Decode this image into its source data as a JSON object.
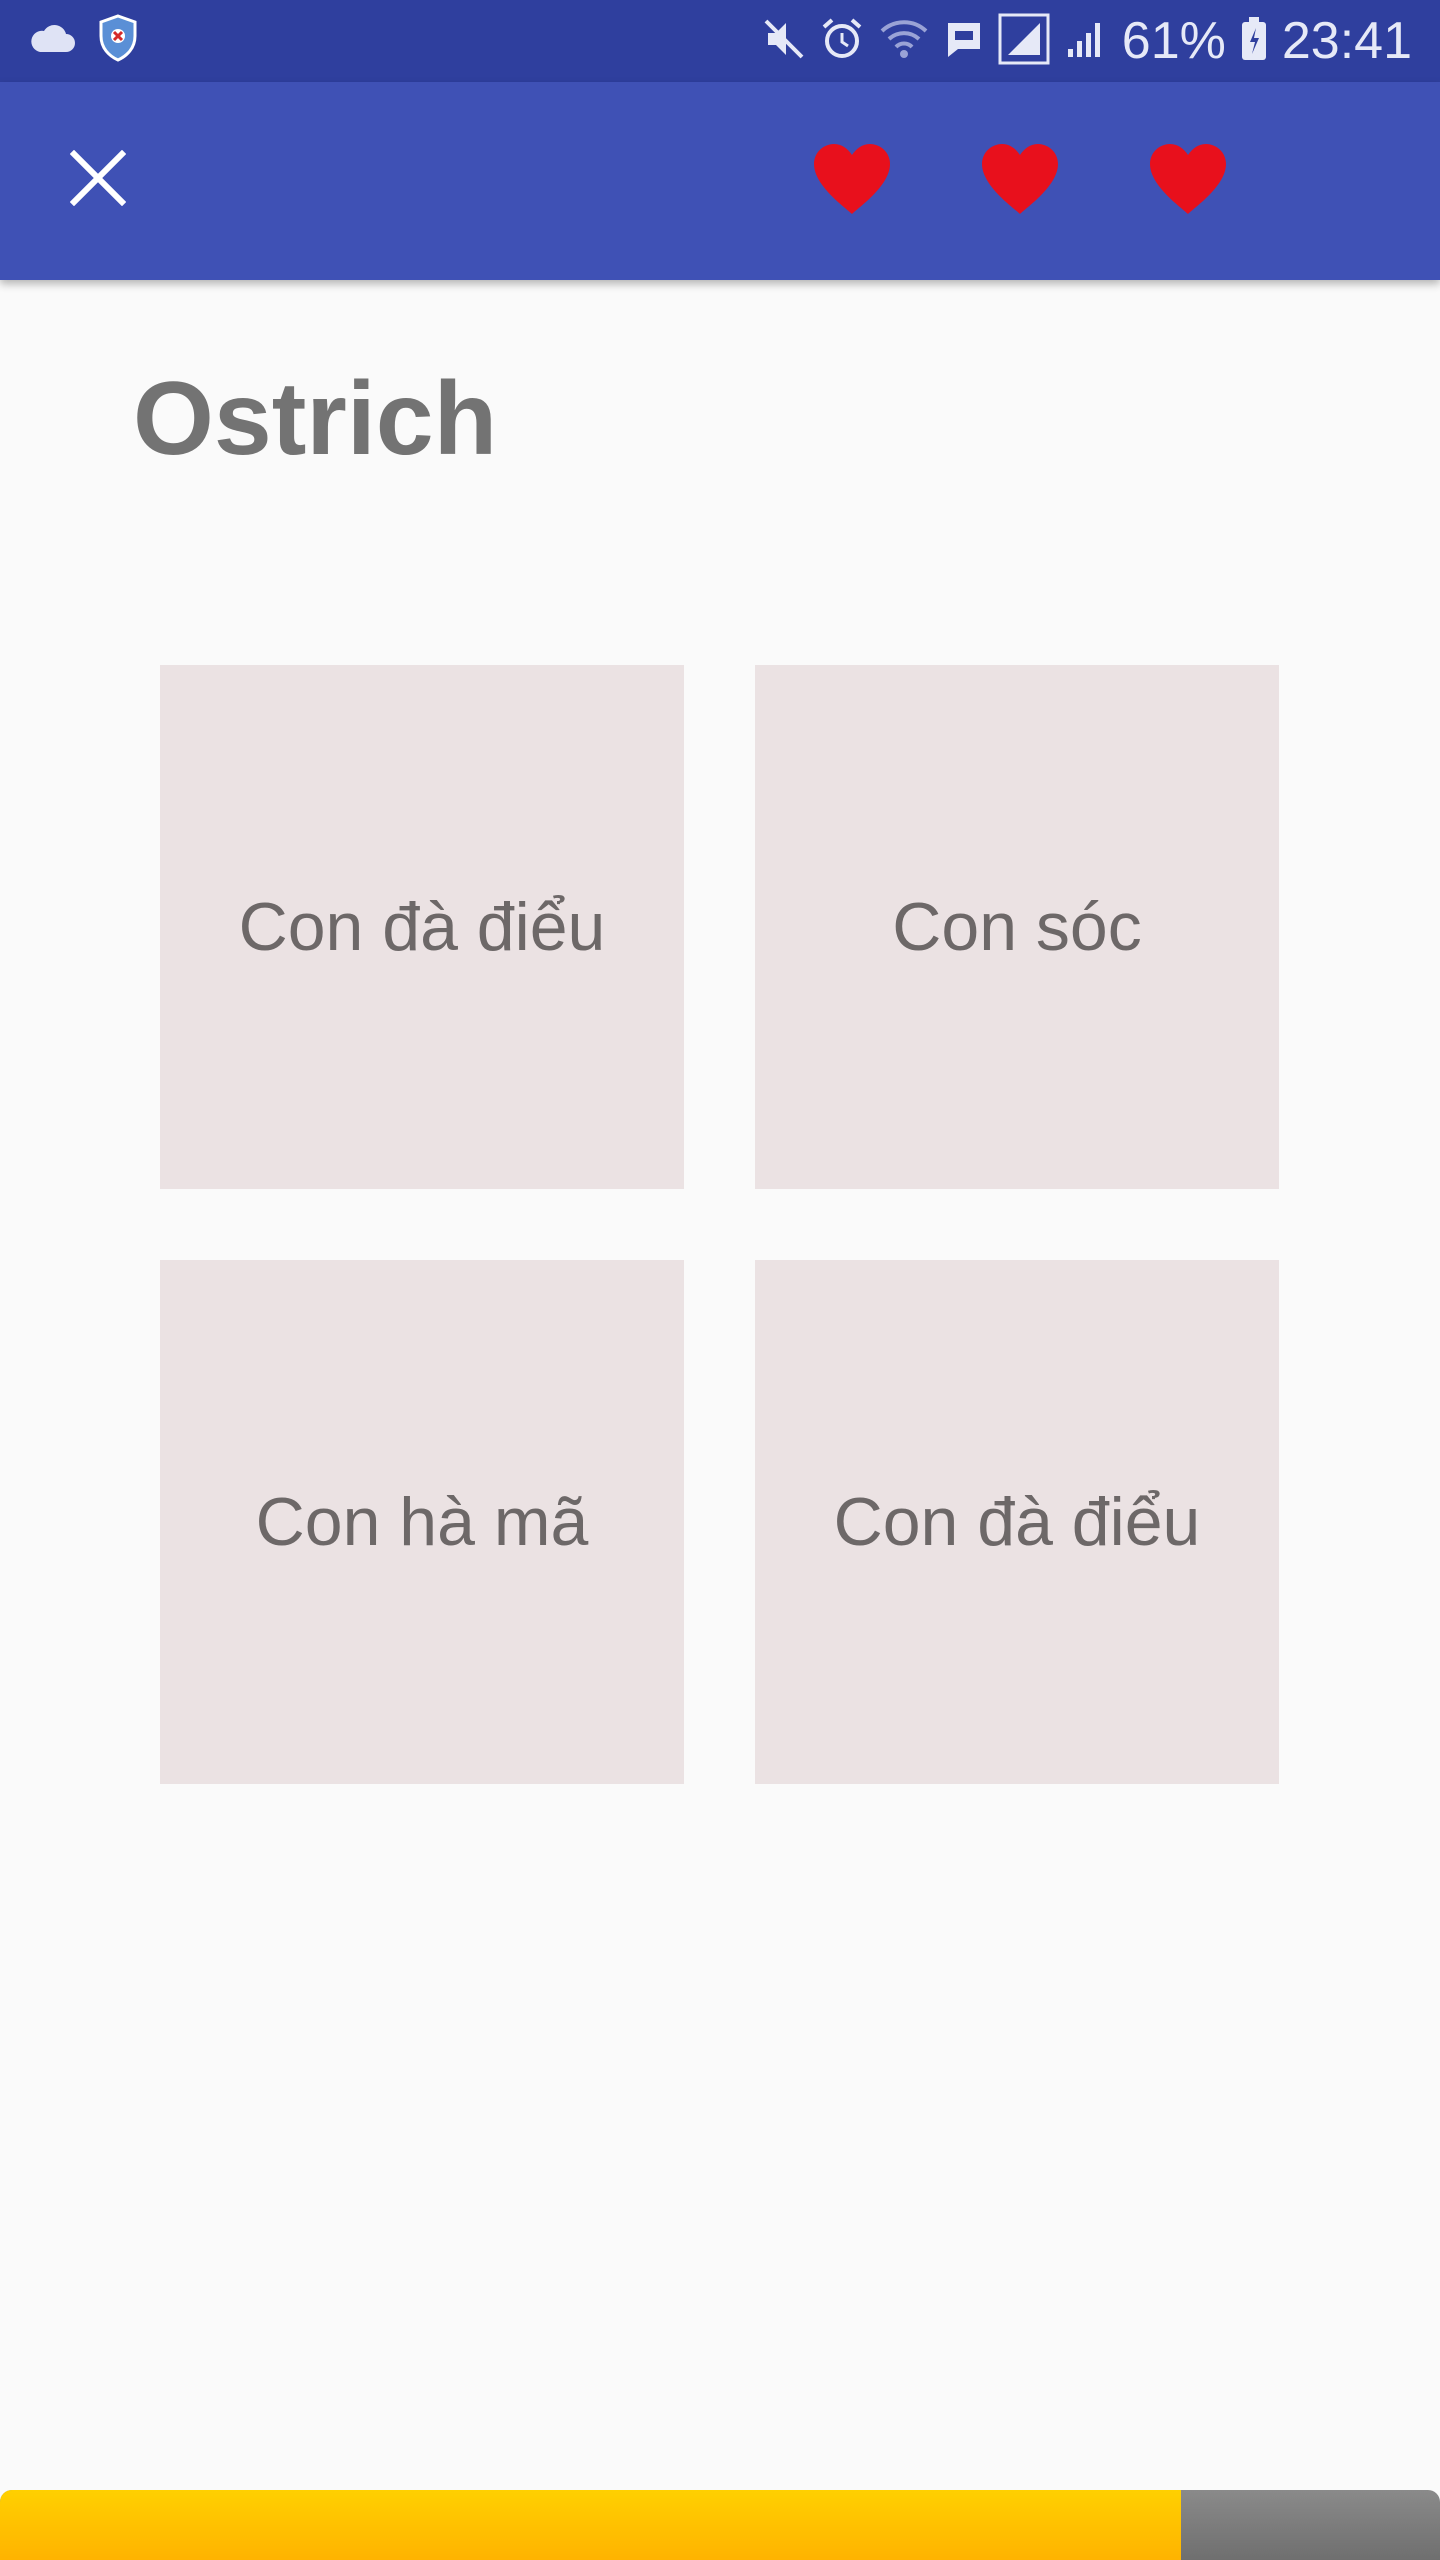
{
  "status_bar": {
    "battery_text": "61%",
    "time": "23:41",
    "icons_left": [
      "cloud-icon",
      "shield-icon"
    ],
    "icons_right": [
      "mute-icon",
      "alarm-icon",
      "wifi-icon",
      "message-icon",
      "signal-icon",
      "signal-icon-2",
      "battery-icon"
    ]
  },
  "app_bar": {
    "close_icon": "close-icon",
    "hearts": [
      "heart-icon",
      "heart-icon",
      "heart-icon"
    ],
    "heart_color": "#e8101c",
    "background": "#3f51b5"
  },
  "question": {
    "word": "Ostrich"
  },
  "answers": [
    {
      "label": "Con đà điểu"
    },
    {
      "label": "Con sóc"
    },
    {
      "label": "Con hà mã"
    },
    {
      "label": "Con đà điểu"
    }
  ],
  "progress": {
    "fraction": 0.82,
    "fill_color": "#ffc400",
    "track_color": "#7a7a7a"
  }
}
